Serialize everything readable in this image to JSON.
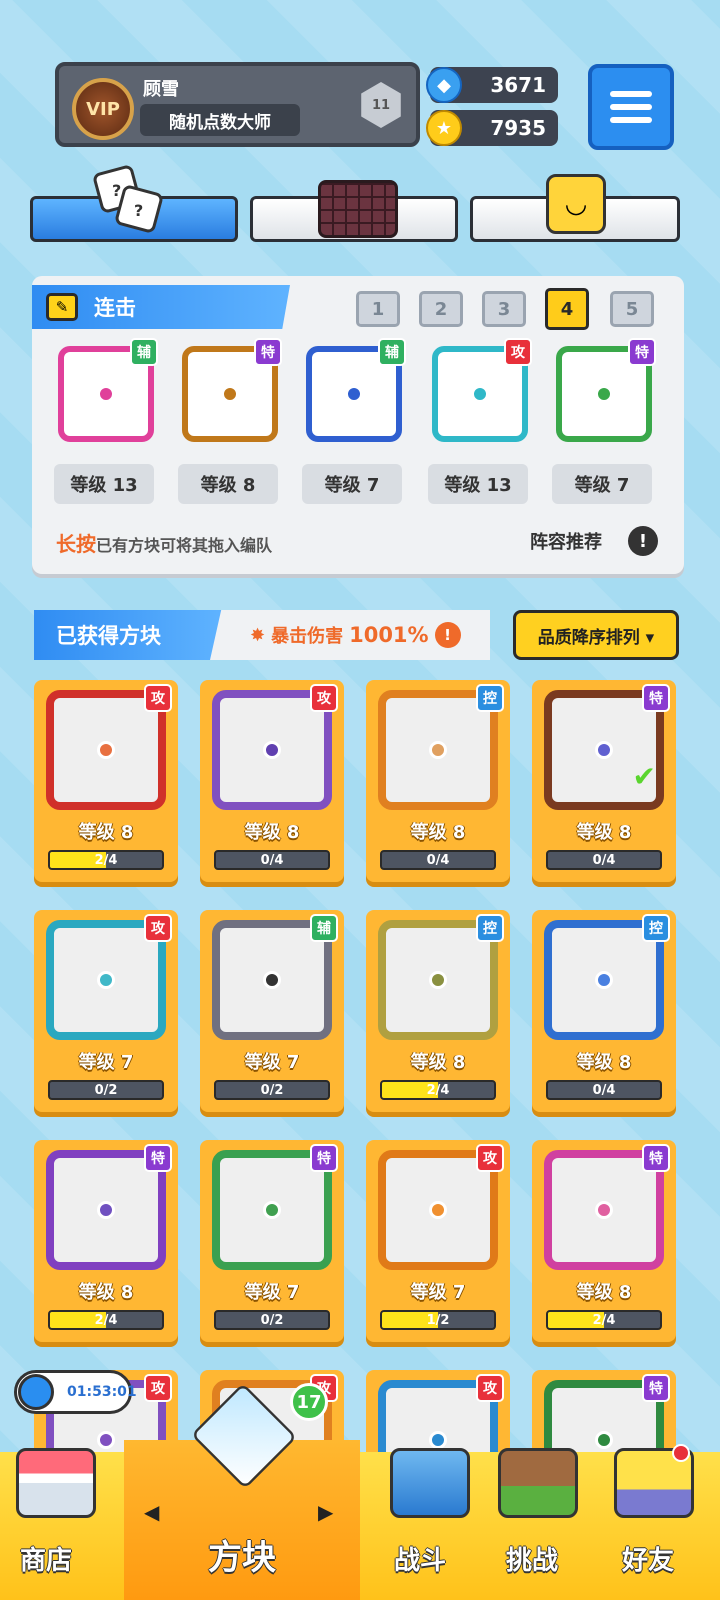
{
  "player": {
    "name": "顾雪",
    "title": "随机点数大师",
    "vip_label": "VIP",
    "rank_label": "11"
  },
  "currency": {
    "gems": "3671",
    "coins": "7935"
  },
  "deck": {
    "header": "连击",
    "deck_tabs": [
      "1",
      "2",
      "3",
      "4",
      "5"
    ],
    "selected_tab": "4",
    "tiles": [
      {
        "tag": "辅",
        "level": "等级 13",
        "color": "#e0409a"
      },
      {
        "tag": "特",
        "level": "等级 8",
        "color": "#c0781a"
      },
      {
        "tag": "辅",
        "level": "等级 7",
        "color": "#2f5fd0"
      },
      {
        "tag": "攻",
        "level": "等级 13",
        "color": "#2fb8c8"
      },
      {
        "tag": "特",
        "level": "等级 7",
        "color": "#3aa84a"
      }
    ],
    "hint_bold": "长按",
    "hint_rest": "已有方块可将其拖入编队",
    "recommend": "阵容推荐"
  },
  "collection": {
    "header": "已获得方块",
    "crit_label": "暴击伤害",
    "crit_value": "1001%",
    "sort_label": "品质降序排列 ▾",
    "cards": [
      {
        "tag": "攻",
        "level": "等级 8",
        "progress": "2/4",
        "fill": 0.5,
        "color": "#d0302a",
        "dot": "#e87040"
      },
      {
        "tag": "攻",
        "level": "等级 8",
        "progress": "0/4",
        "fill": 0,
        "color": "#8050c0",
        "dot": "#6040b0"
      },
      {
        "tag": "控",
        "level": "等级 8",
        "progress": "0/4",
        "fill": 0,
        "color": "#e08020",
        "dot": "#e0a060"
      },
      {
        "tag": "特",
        "level": "等级 8",
        "progress": "0/4",
        "fill": 0,
        "color": "#7a3a20",
        "dot": "#6060d0"
      },
      {
        "tag": "攻",
        "level": "等级 7",
        "progress": "0/2",
        "fill": 0,
        "color": "#2aa8c0",
        "dot": "#40b8c8"
      },
      {
        "tag": "辅",
        "level": "等级 7",
        "progress": "0/2",
        "fill": 0,
        "color": "#707080",
        "dot": "#333333"
      },
      {
        "tag": "控",
        "level": "等级 8",
        "progress": "2/4",
        "fill": 0.5,
        "color": "#b0a040",
        "dot": "#8a9040"
      },
      {
        "tag": "控",
        "level": "等级 8",
        "progress": "0/4",
        "fill": 0,
        "color": "#2f6fd0",
        "dot": "#4a80e0"
      },
      {
        "tag": "特",
        "level": "等级 8",
        "progress": "2/4",
        "fill": 0.5,
        "color": "#8040c0",
        "dot": "#7050c0"
      },
      {
        "tag": "特",
        "level": "等级 7",
        "progress": "0/2",
        "fill": 0,
        "color": "#3aa050",
        "dot": "#40a050"
      },
      {
        "tag": "攻",
        "level": "等级 7",
        "progress": "1/2",
        "fill": 0.5,
        "color": "#e07a18",
        "dot": "#f09030"
      },
      {
        "tag": "特",
        "level": "等级 8",
        "progress": "2/4",
        "fill": 0.5,
        "color": "#d040a0",
        "dot": "#e060a0"
      },
      {
        "tag": "攻",
        "color": "#8050c0"
      },
      {
        "tag": "攻",
        "color": "#e08020"
      },
      {
        "tag": "攻",
        "color": "#2a8ad0"
      },
      {
        "tag": "特",
        "color": "#2f8a40"
      }
    ]
  },
  "timer": "01:53:01",
  "nav": {
    "shop": "商店",
    "dice": "方块",
    "dice_badge": "17",
    "battle": "战斗",
    "challenge": "挑战",
    "friends": "好友"
  },
  "tag_colors": {
    "攻": "#e8303a",
    "特": "#8a3ad0",
    "辅": "#2fb060",
    "控": "#2a8ee0"
  }
}
